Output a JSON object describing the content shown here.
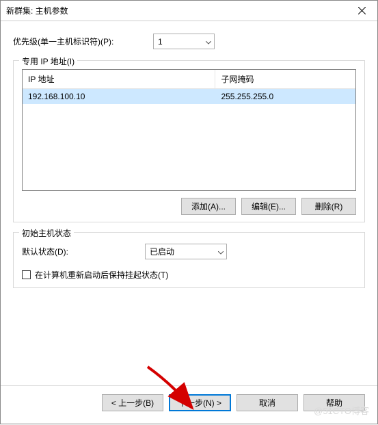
{
  "titlebar": {
    "title": "新群集: 主机参数"
  },
  "priority": {
    "label": "优先级(单一主机标识符)(P):",
    "value": "1"
  },
  "ip_group": {
    "legend": "专用 IP 地址(I)",
    "columns": {
      "ip": "IP 地址",
      "mask": "子网掩码"
    },
    "rows": [
      {
        "ip": "192.168.100.10",
        "mask": "255.255.255.0"
      }
    ],
    "buttons": {
      "add": "添加(A)...",
      "edit": "编辑(E)...",
      "remove": "删除(R)"
    }
  },
  "state_group": {
    "legend": "初始主机状态",
    "default_label": "默认状态(D):",
    "default_value": "已启动",
    "checkbox_label": "在计算机重新启动后保持挂起状态(T)"
  },
  "footer": {
    "back": "< 上一步(B)",
    "next": "下一步(N) >",
    "cancel": "取消",
    "help": "帮助"
  },
  "watermark": "@51CTO博客"
}
